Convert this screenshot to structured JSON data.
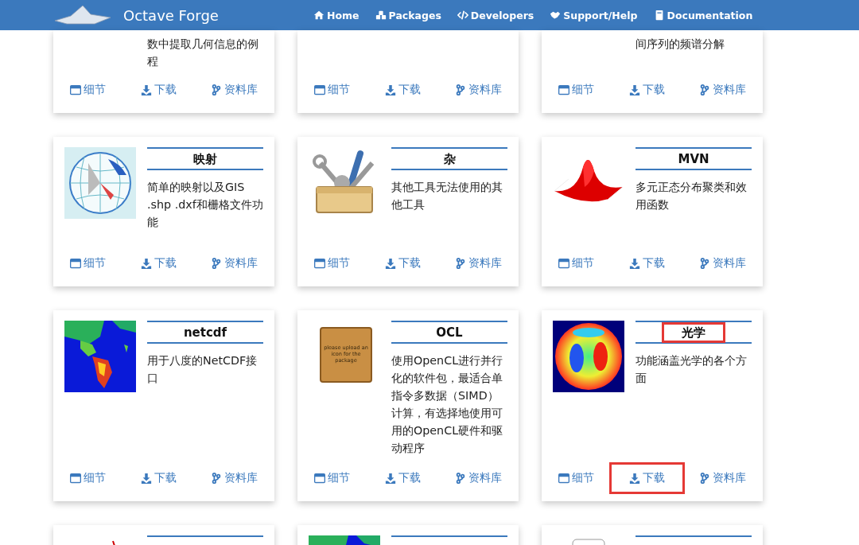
{
  "navbar": {
    "brand": "Octave Forge",
    "links": [
      {
        "label": "Home"
      },
      {
        "label": "Packages"
      },
      {
        "label": "Developers"
      },
      {
        "label": "Support/Help"
      },
      {
        "label": "Documentation"
      }
    ]
  },
  "rows": [
    {
      "cards": [
        {
          "kind": "tail",
          "description": "数中提取几何信息的例程",
          "actions": [
            {
              "kind": "details",
              "label": "细节",
              "highlighted": false
            },
            {
              "kind": "download",
              "label": "下载",
              "highlighted": false
            },
            {
              "kind": "repo",
              "label": "资料库",
              "highlighted": false
            }
          ]
        },
        {
          "kind": "tail",
          "actions": [
            {
              "kind": "details",
              "label": "细节",
              "highlighted": false
            },
            {
              "kind": "download",
              "label": "下载",
              "highlighted": false
            },
            {
              "kind": "repo",
              "label": "资料库",
              "highlighted": false
            }
          ]
        },
        {
          "kind": "tail",
          "description": "间序列的频谱分解",
          "actions": [
            {
              "kind": "details",
              "label": "细节",
              "highlighted": false
            },
            {
              "kind": "download",
              "label": "下载",
              "highlighted": false
            },
            {
              "kind": "repo",
              "label": "资料库",
              "highlighted": false
            }
          ]
        }
      ]
    },
    {
      "cards": [
        {
          "kind": "full",
          "title": "映射",
          "title_highlighted": false,
          "description": "简单的映射以及GIS .shp .dxf和栅格文件功能",
          "actions": [
            {
              "kind": "details",
              "label": "细节",
              "highlighted": false
            },
            {
              "kind": "download",
              "label": "下载",
              "highlighted": false
            },
            {
              "kind": "repo",
              "label": "资料库",
              "highlighted": false
            }
          ]
        },
        {
          "kind": "full",
          "title": "杂",
          "title_highlighted": false,
          "description": "其他工具无法使用的其他工具",
          "actions": [
            {
              "kind": "details",
              "label": "细节",
              "highlighted": false
            },
            {
              "kind": "download",
              "label": "下载",
              "highlighted": false
            },
            {
              "kind": "repo",
              "label": "资料库",
              "highlighted": false
            }
          ]
        },
        {
          "kind": "full",
          "title": "MVN",
          "title_highlighted": false,
          "description": "多元正态分布聚类和效用函数",
          "actions": [
            {
              "kind": "details",
              "label": "细节",
              "highlighted": false
            },
            {
              "kind": "download",
              "label": "下载",
              "highlighted": false
            },
            {
              "kind": "repo",
              "label": "资料库",
              "highlighted": false
            }
          ]
        }
      ]
    },
    {
      "cards": [
        {
          "kind": "full",
          "title": "netcdf",
          "title_highlighted": false,
          "description": "用于八度的NetCDF接口",
          "actions": [
            {
              "kind": "details",
              "label": "细节",
              "highlighted": false
            },
            {
              "kind": "download",
              "label": "下载",
              "highlighted": false
            },
            {
              "kind": "repo",
              "label": "资料库",
              "highlighted": false
            }
          ]
        },
        {
          "kind": "full",
          "image_text": "please upload an icon for the package",
          "title": "OCL",
          "title_highlighted": false,
          "description": "使用OpenCL进行并行化的软件包，最适合单指令多数据（SIMD）计算，有选择地使用可用的OpenCL硬件和驱动程序",
          "actions": [
            {
              "kind": "details",
              "label": "细节",
              "highlighted": false
            },
            {
              "kind": "download",
              "label": "下载",
              "highlighted": false
            },
            {
              "kind": "repo",
              "label": "资料库",
              "highlighted": false
            }
          ]
        },
        {
          "kind": "full",
          "title": "光学",
          "title_highlighted": true,
          "description": "功能涵盖光学的各个方面",
          "actions": [
            {
              "kind": "details",
              "label": "细节",
              "highlighted": false
            },
            {
              "kind": "download",
              "label": "下载",
              "highlighted": true
            },
            {
              "kind": "repo",
              "label": "资料库",
              "highlighted": false
            }
          ]
        }
      ]
    },
    {
      "cards": [
        {
          "kind": "head"
        },
        {
          "kind": "head"
        },
        {
          "kind": "head"
        }
      ]
    }
  ]
}
